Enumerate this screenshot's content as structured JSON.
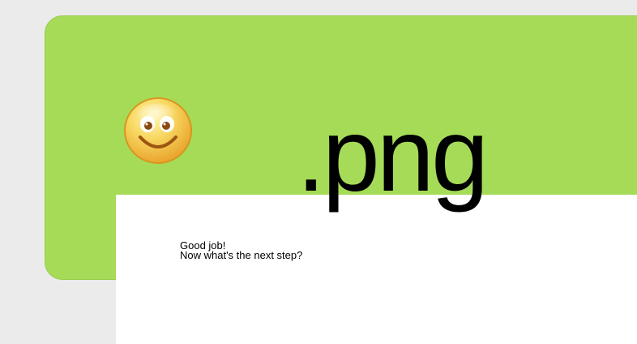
{
  "title": ".png",
  "message": {
    "line1": "Good job!",
    "line2": "Now what's the next step?"
  },
  "icon": "smiley-face-icon",
  "colors": {
    "background": "#ebebeb",
    "panel": "#a6db58",
    "card": "#ffffff",
    "text": "#000000"
  }
}
